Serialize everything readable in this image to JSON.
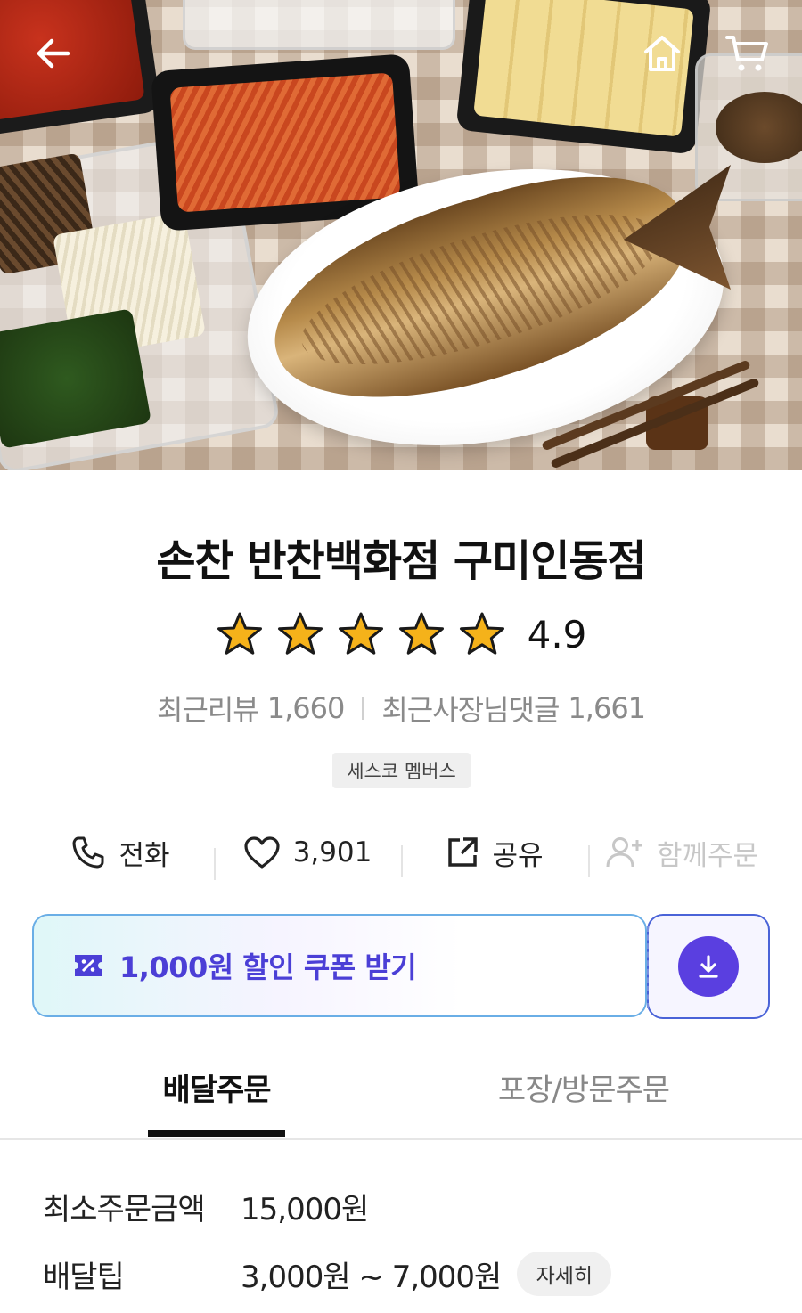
{
  "hero": {
    "description_icons": [
      "back-arrow-icon",
      "home-icon",
      "cart-icon"
    ]
  },
  "store": {
    "name": "손찬 반찬백화점 구미인동점",
    "rating": "4.9",
    "rating_value": 4.9,
    "stars_filled": 5,
    "recent_review_label": "최근리뷰",
    "recent_review_count": "1,660",
    "owner_reply_label": "최근사장님댓글",
    "owner_reply_count": "1,661",
    "badge": "세스코 멤버스"
  },
  "actions": {
    "call": "전화",
    "likes": "3,901",
    "share": "공유",
    "group_order": "함께주문"
  },
  "coupon": {
    "label": "1,000원 할인 쿠폰 받기",
    "accent": "#4b3fd6"
  },
  "tabs": {
    "delivery": "배달주문",
    "pickup": "포장/방문주문",
    "active": "delivery"
  },
  "info": {
    "min_order_label": "최소주문금액",
    "min_order_value": "15,000원",
    "delivery_tip_label": "배달팁",
    "delivery_tip_value": "3,000원 ~ 7,000원",
    "detail_button": "자세히"
  },
  "colors": {
    "star": "#f5b21a",
    "coupon_button": "#5a3fe0"
  }
}
